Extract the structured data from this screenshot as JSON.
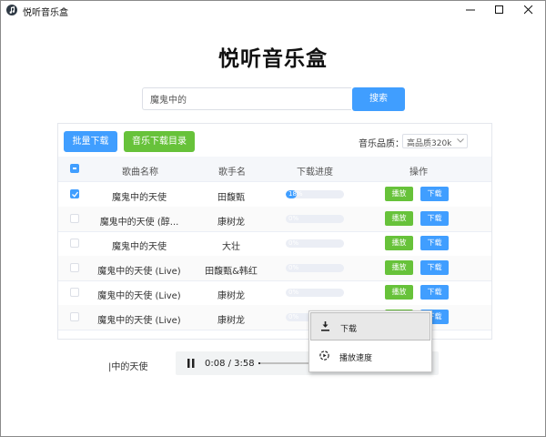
{
  "window": {
    "title": "悦听音乐盒",
    "app_icon": "music-note-icon",
    "controls": [
      "minimize-icon",
      "maximize-icon",
      "close-icon"
    ]
  },
  "header": {
    "title": "悦听音乐盒"
  },
  "search": {
    "value": "魔鬼中的",
    "button_label": "搜索"
  },
  "toolbar": {
    "batch_download_label": "批量下载",
    "download_dir_label": "音乐下载目录",
    "quality_label": "音乐品质：",
    "quality_selected": "高品质320k"
  },
  "table": {
    "columns": [
      "歌曲名称",
      "歌手名",
      "下载进度",
      "操作"
    ],
    "play_label": "播放",
    "download_label": "下载",
    "rows": [
      {
        "checked": true,
        "song": "魔鬼中的天使",
        "artist": "田馥甄",
        "progress": 0.18,
        "progress_text": "18%"
      },
      {
        "checked": false,
        "song": "魔鬼中的天使 (醇...",
        "artist": "康树龙",
        "progress": 0,
        "progress_text": "0%"
      },
      {
        "checked": false,
        "song": "魔鬼中的天使",
        "artist": "大壮",
        "progress": 0,
        "progress_text": "0%"
      },
      {
        "checked": false,
        "song": "魔鬼中的天使 (Live)",
        "artist": "田馥甄&韩红",
        "progress": 0,
        "progress_text": "0%"
      },
      {
        "checked": false,
        "song": "魔鬼中的天使 (Live)",
        "artist": "康树龙",
        "progress": 0,
        "progress_text": "0%"
      },
      {
        "checked": false,
        "song": "魔鬼中的天使 (Live)",
        "artist": "康树龙",
        "progress": 0,
        "progress_text": "0%"
      }
    ]
  },
  "player": {
    "now_playing": "|中的天使",
    "time": "0:08 / 3:58",
    "progress": 0.034,
    "pause_icon": "pause-icon"
  },
  "context_menu": {
    "items": [
      {
        "label": "下载",
        "icon": "download-icon"
      },
      {
        "label": "播放速度",
        "icon": "playback-speed-icon"
      }
    ]
  },
  "colors": {
    "primary": "#409eff",
    "success": "#67c23a"
  }
}
